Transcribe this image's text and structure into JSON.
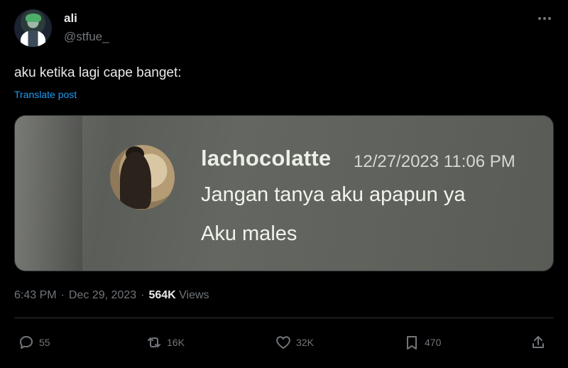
{
  "author": {
    "name": "ali",
    "handle": "@stfue_"
  },
  "post": {
    "text": "aku ketika lagi cape banget:",
    "translate_label": "Translate post"
  },
  "media": {
    "username": "lachocolatte",
    "timestamp": "12/27/2023 11:06 PM",
    "line1": "Jangan tanya aku apapun ya",
    "line2": "Aku males"
  },
  "meta": {
    "time": "6:43 PM",
    "separator": "·",
    "date": "Dec 29, 2023",
    "views_count": "564K",
    "views_label": "Views"
  },
  "actions": {
    "replies": "55",
    "reposts": "16K",
    "likes": "32K",
    "bookmarks": "470"
  },
  "icons": [
    "more-icon",
    "reply-icon",
    "repost-icon",
    "like-icon",
    "bookmark-icon",
    "share-icon"
  ],
  "colors": {
    "background": "#000000",
    "text": "#e7e9ea",
    "muted": "#71767b",
    "link": "#1d9bf0",
    "border": "#2f3336"
  }
}
